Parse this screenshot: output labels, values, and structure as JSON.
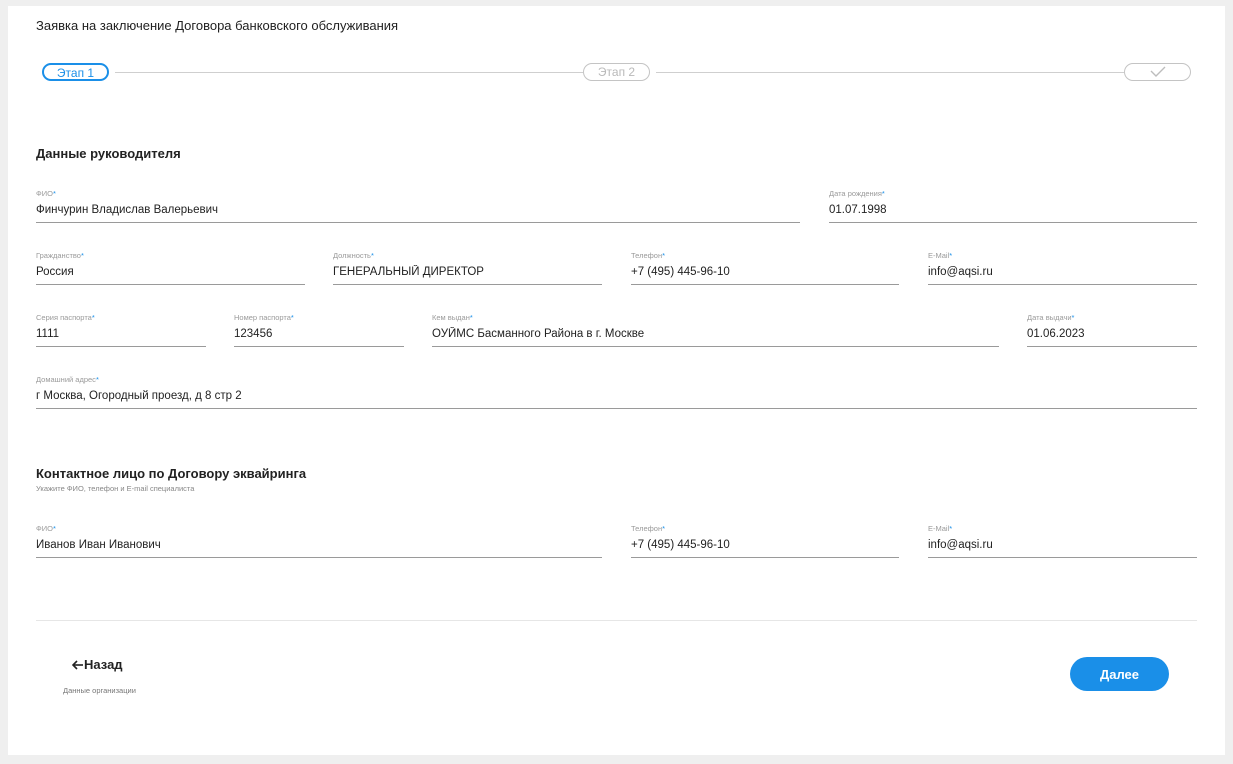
{
  "page": {
    "title": "Заявка на заключение Договора банковского обслуживания"
  },
  "stepper": {
    "step1": "Этап 1",
    "step2": "Этап 2",
    "step3_icon": "check-icon"
  },
  "director": {
    "section_title": "Данные руководителя",
    "fields": {
      "fio": {
        "label": "ФИО",
        "value": "Финчурин Владислав Валерьевич"
      },
      "birth_date": {
        "label": "Дата рождения",
        "value": "01.07.1998"
      },
      "citizenship": {
        "label": "Гражданство",
        "value": "Россия"
      },
      "position": {
        "label": "Должность",
        "value": "ГЕНЕРАЛЬНЫЙ ДИРЕКТОР"
      },
      "phone": {
        "label": "Телефон",
        "value": "+7 (495) 445-96-10"
      },
      "email": {
        "label": "E-Mail",
        "value": "info@aqsi.ru"
      },
      "passport_series": {
        "label": "Серия паспорта",
        "value": "1111"
      },
      "passport_number": {
        "label": "Номер паспорта",
        "value": "123456"
      },
      "issued_by": {
        "label": "Кем выдан",
        "value": "ОУЙМС Басманного Района в г. Москве"
      },
      "issue_date": {
        "label": "Дата выдачи",
        "value": "01.06.2023"
      },
      "home_address": {
        "label": "Домашний адрес",
        "value": "г Москва, Огородный проезд, д 8 стр 2"
      }
    }
  },
  "contact": {
    "section_title": "Контактное лицо по Договору эквайринга",
    "section_subtitle": "Укажите ФИО, телефон и E-mail специалиста",
    "fields": {
      "fio": {
        "label": "ФИО",
        "value": "Иванов Иван Иванович"
      },
      "phone": {
        "label": "Телефон",
        "value": "+7 (495) 445-96-10"
      },
      "email": {
        "label": "E-Mail",
        "value": "info@aqsi.ru"
      }
    }
  },
  "required_mark": "*",
  "navigation": {
    "back_icon": "arrow-left-icon",
    "back_label": "Назад",
    "back_sublabel": "Данные организации",
    "next_label": "Далее"
  },
  "colors": {
    "accent": "#1a8fe8",
    "background": "#efefef",
    "card": "#ffffff"
  }
}
